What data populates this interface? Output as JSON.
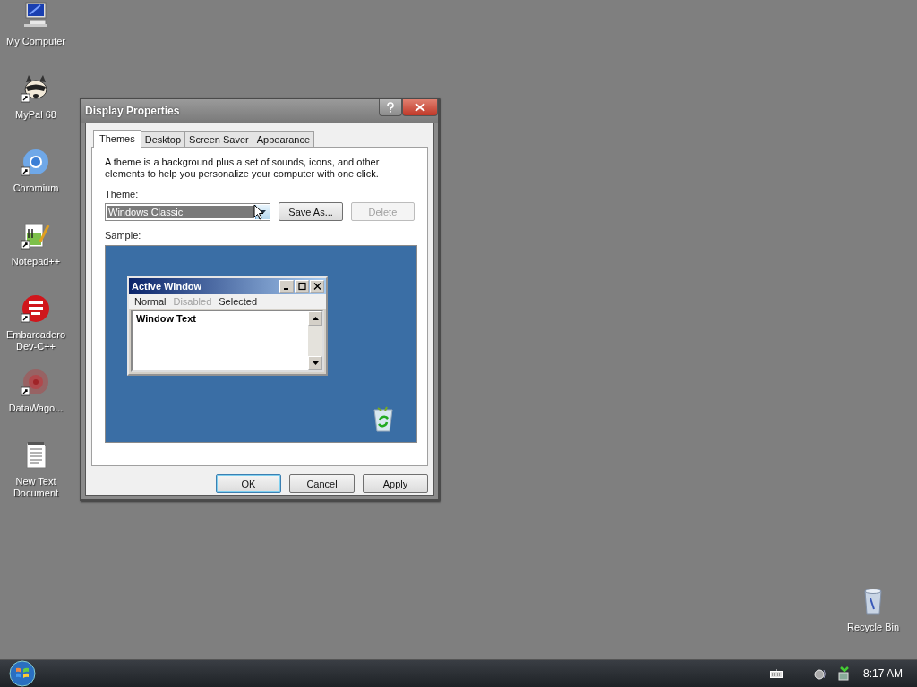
{
  "desktop_icons": [
    {
      "label": "My Computer",
      "kind": "computer",
      "shortcut": false
    },
    {
      "label": "MyPal 68",
      "kind": "raccoon",
      "shortcut": true
    },
    {
      "label": "Chromium",
      "kind": "chromium",
      "shortcut": true
    },
    {
      "label": "Notepad++",
      "kind": "notepad",
      "shortcut": true
    },
    {
      "label": "Embarcadero Dev-C++",
      "kind": "devcpp",
      "shortcut": true
    },
    {
      "label": "DataWago...",
      "kind": "burst",
      "shortcut": true
    },
    {
      "label": "New Text Document",
      "kind": "textdoc",
      "shortcut": false
    }
  ],
  "recycle_bin": {
    "label": "Recycle Bin"
  },
  "dialog": {
    "title": "Display Properties",
    "tabs": [
      {
        "label": "Themes",
        "selected": true
      },
      {
        "label": "Desktop",
        "selected": false
      },
      {
        "label": "Screen Saver",
        "selected": false
      },
      {
        "label": "Appearance",
        "selected": false
      }
    ],
    "description": "A theme is a background plus a set of sounds, icons, and other elements to help you personalize your computer with one click.",
    "theme_label": "Theme:",
    "theme_select": {
      "value": "Windows Classic"
    },
    "theme_buttons": [
      {
        "label": "Save As...",
        "disabled": false
      },
      {
        "label": "Delete",
        "disabled": true
      }
    ],
    "sample_label": "Sample:",
    "sample": {
      "window_title": "Active Window",
      "menu": [
        {
          "label": "Normal",
          "disabled": false
        },
        {
          "label": "Disabled",
          "disabled": true
        },
        {
          "label": "Selected",
          "disabled": false
        }
      ],
      "window_text": "Window Text"
    },
    "buttons": [
      {
        "label": "OK",
        "default": true
      },
      {
        "label": "Cancel",
        "default": false
      },
      {
        "label": "Apply",
        "default": false
      }
    ]
  },
  "taskbar": {
    "clock": "8:17 AM"
  }
}
